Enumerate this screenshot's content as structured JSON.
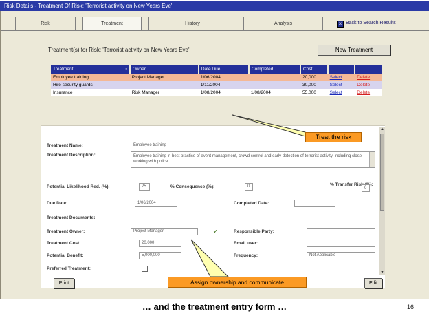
{
  "window": {
    "title": "Risk Details - Treatment Of Risk: 'Terrorist activity on New Years Eve'"
  },
  "tabs": [
    "Risk",
    "Treatment",
    "History",
    "Analysis"
  ],
  "active_tab": "Treatment",
  "back_button": "Back to Search Results",
  "section_title": "Treatment(s) for Risk: 'Terrorist activity on New Years Eve'",
  "new_treatment_button": "New Treatment",
  "grid": {
    "columns": [
      "Treatment",
      "Owner",
      "Date Due",
      "Completed",
      "Cost",
      "",
      ""
    ],
    "rows": [
      {
        "treatment": "Employee training",
        "owner": "Project Manager",
        "due": "1/06/2004",
        "completed": "",
        "cost": "20,000",
        "select": "Select",
        "delete": "Delete"
      },
      {
        "treatment": "Hire security guards",
        "owner": "",
        "due": "1/11/2004",
        "completed": "",
        "cost": "30,000",
        "select": "Select",
        "delete": "Delete"
      },
      {
        "treatment": "Insurance",
        "owner": "Risk Manager",
        "due": "1/08/2004",
        "completed": "1/08/2004",
        "cost": "55,000",
        "select": "Select",
        "delete": "Delete"
      }
    ]
  },
  "form": {
    "treatment_name_label": "Treatment Name:",
    "treatment_name_value": "Employee training",
    "description_label": "Treatment Description:",
    "description_value": "Employee training in best practice of event management, crowd control and early detection of terrorist activity, including close working with police.",
    "likelihood_label": "Potential Likelihood Red. (%):",
    "likelihood_value": "25",
    "consequence_label": "% Consequence (%):",
    "consequence_value": "0",
    "transfer_label": "% Transfer Risk (%):",
    "transfer_value": "0",
    "due_date_label": "Due Date:",
    "due_date_value": "1/06/2004",
    "completed_date_label": "Completed Date:",
    "completed_date_value": "",
    "documents_label": "Treatment Documents:",
    "owner_label": "Treatment Owner:",
    "owner_value": "Project Manager",
    "responsible_label": "Responsible Party:",
    "responsible_value": "",
    "cost_label": "Treatment Cost:",
    "cost_value": "20,000",
    "email_label": "Email user:",
    "email_value": "",
    "benefit_label": "Potential Benefit:",
    "benefit_value": "5,000,000",
    "frequency_label": "Frequency:",
    "frequency_value": "Not Applicable",
    "preferred_label": "Preferred Treatment:",
    "preferred_checked": false
  },
  "print_button": "Print",
  "edit_button": "Edit",
  "callouts": {
    "treat": "Treat the risk",
    "assign": "Assign ownership and communicate"
  },
  "colors": {
    "accent": "#24309a",
    "callout": "#fb9a24"
  },
  "slide": {
    "caption": "… and the treatment entry form …",
    "page_number": "16"
  }
}
